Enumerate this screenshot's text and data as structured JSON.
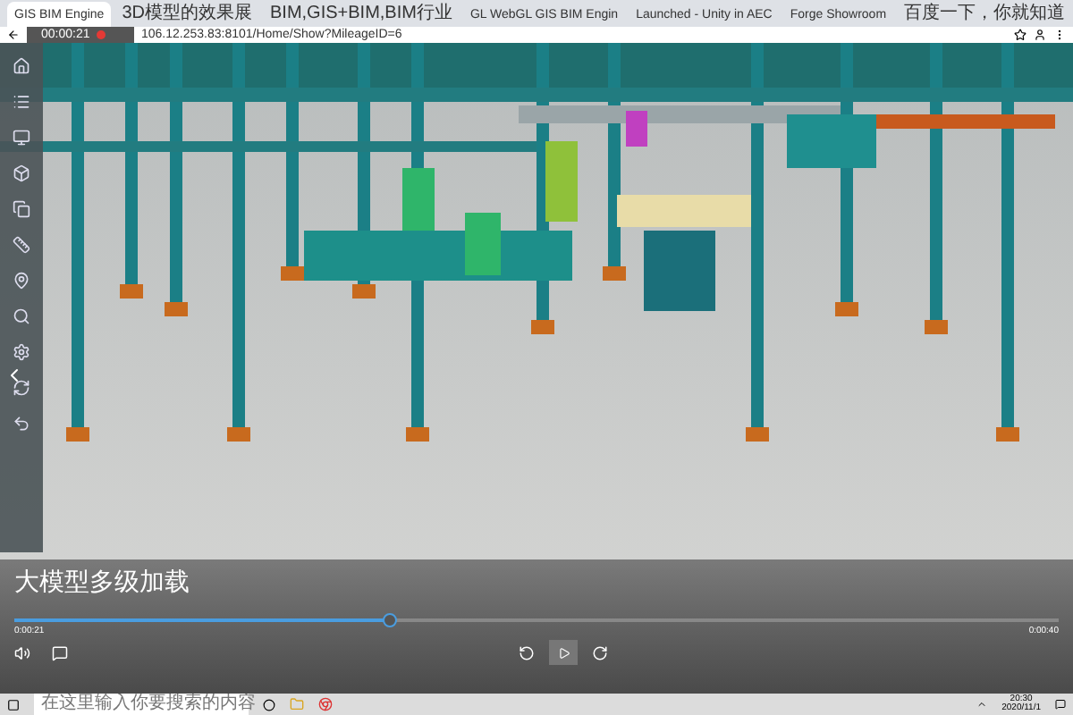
{
  "browser": {
    "tabs": [
      {
        "title": "GIS BIM Engine",
        "selected": true
      },
      {
        "title": "3D模型的效果展",
        "selected": false
      },
      {
        "title": "BIM,GIS+BIM,BIM行业",
        "selected": false
      },
      {
        "title": "GL WebGL GIS BIM Engin",
        "selected": false
      },
      {
        "title": "Launched - Unity in AEC",
        "selected": false
      },
      {
        "title": "Forge Showroom",
        "selected": false
      },
      {
        "title": "百度一下，你就知道",
        "selected": false
      }
    ],
    "url": "106.12.253.83:8101/Home/Show?MileageID=6"
  },
  "recorder": {
    "elapsed": "00:00:21"
  },
  "video": {
    "caption": "大模型多级加载",
    "current_time": "0:00:21",
    "total_time": "0:00:40",
    "level": 0.36
  },
  "taskbar": {
    "search_placeholder": "在这里输入你要搜索的内容",
    "time": "20:30",
    "date": "2020/11/1"
  }
}
